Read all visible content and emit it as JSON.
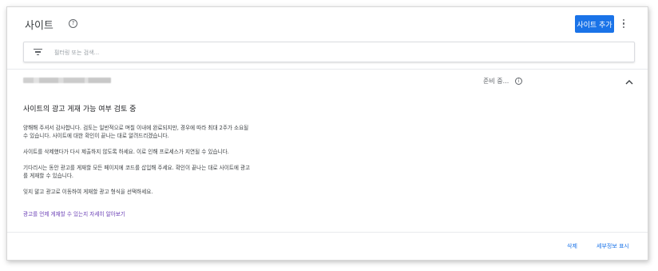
{
  "header": {
    "title": "사이트",
    "help_icon": "help-circle-icon",
    "add_site_label": "사이트 추가",
    "more_icon": "more-vert-icon"
  },
  "search": {
    "placeholder": "필터링 또는 검색...",
    "filter_icon": "filter-list-icon"
  },
  "site": {
    "status": "준비 중...",
    "info_icon": "info-icon",
    "expand_icon": "chevron-up-icon"
  },
  "details": {
    "heading": "사이트의 광고 게재 가능 여부 검토 중",
    "para1_line1": "양해해 주셔서 감사합니다. 검토는 일반적으로 며칠 이내에 완료되지만, 경우에 따라 최대 2주가 소요될",
    "para1_line2": "수 있습니다. 사이트에 대한 확인이 끝나는 대로 알려드리겠습니다.",
    "para2": "사이트를 삭제했다가 다시 제출하지 않도록 하세요. 이로 인해 프로세스가 지연될 수 있습니다.",
    "para3_line1": "기다리시는 동안 광고를 게재할 모든 페이지에 코드를 삽입해 주세요. 확인이 끝나는 대로 사이트에 광고",
    "para3_line2": "를 게재할 수 있습니다.",
    "para4": "잊지 말고 광고로 이동하여 게재할 광고 형식을 선택하세요.",
    "learn_more": "광고를 언제 게재할 수 있는지 자세히 알아보기"
  },
  "footer": {
    "delete_label": "삭제",
    "details_label": "세부정보 표시"
  },
  "colors": {
    "accent": "#1a73e8",
    "link_visited": "#6a3fb5"
  }
}
